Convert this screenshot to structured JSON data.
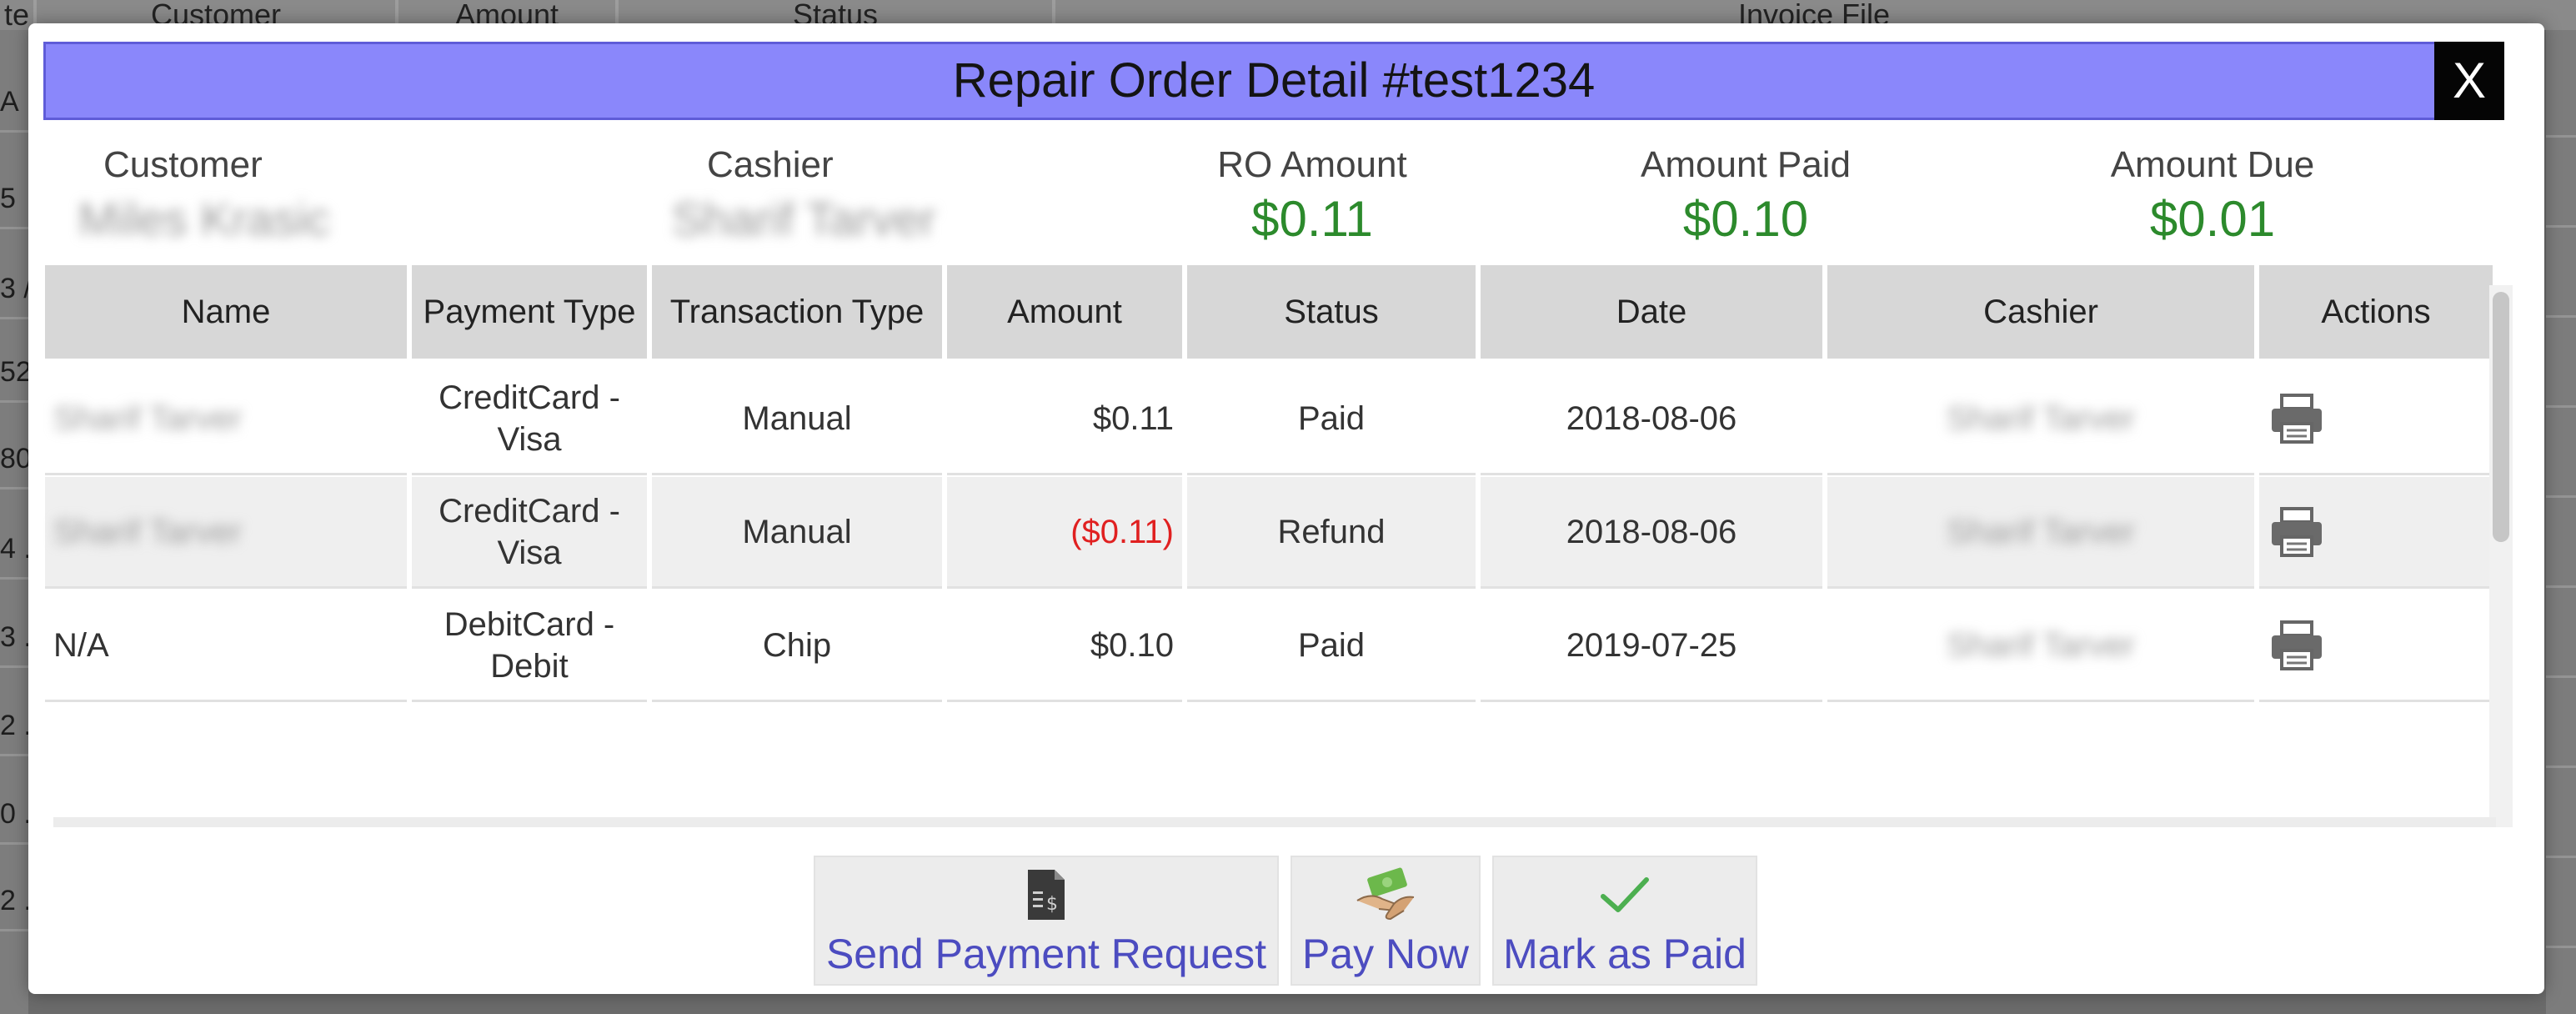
{
  "background": {
    "columns": [
      "te",
      "Customer",
      "Amount",
      "Status",
      "Invoice File"
    ],
    "left_cells": [
      "A",
      "5",
      "3 /",
      "52",
      "80",
      "4 .",
      "3 .",
      "2 .",
      "0 .",
      "2 ."
    ]
  },
  "modal": {
    "title": "Repair Order Detail #test1234",
    "close_label": "X",
    "summary": {
      "customer_label": "Customer",
      "customer_value": "Miles Krasic",
      "cashier_label": "Cashier",
      "cashier_value": "Sharif Tarver",
      "ro_amount_label": "RO Amount",
      "ro_amount_value": "$0.11",
      "amount_paid_label": "Amount Paid",
      "amount_paid_value": "$0.10",
      "amount_due_label": "Amount Due",
      "amount_due_value": "$0.01"
    },
    "table": {
      "headers": [
        "Name",
        "Payment Type",
        "Transaction Type",
        "Amount",
        "Status",
        "Date",
        "Cashier",
        "Actions"
      ],
      "rows": [
        {
          "name": "Sharif Tarver",
          "payment_type": "CreditCard - Visa",
          "transaction_type": "Manual",
          "amount": "$0.11",
          "status": "Paid",
          "date": "2018-08-06",
          "cashier": "Sharif Tarver"
        },
        {
          "name": "Sharif Tarver",
          "payment_type": "CreditCard - Visa",
          "transaction_type": "Manual",
          "amount": "($0.11)",
          "status": "Refund",
          "date": "2018-08-06",
          "cashier": "Sharif Tarver"
        },
        {
          "name": "N/A",
          "payment_type": "DebitCard - Debit",
          "transaction_type": "Chip",
          "amount": "$0.10",
          "status": "Paid",
          "date": "2019-07-25",
          "cashier": "Sharif Tarver"
        }
      ],
      "action_icon": "printer-icon"
    },
    "buttons": {
      "send_payment_request": "Send Payment Request",
      "pay_now": "Pay Now",
      "mark_as_paid": "Mark as Paid"
    },
    "colors": {
      "title_bar": "#8a87fb",
      "money_green": "#2c8a2c",
      "negative_red": "#e02020",
      "button_text": "#4c4cc0"
    }
  }
}
